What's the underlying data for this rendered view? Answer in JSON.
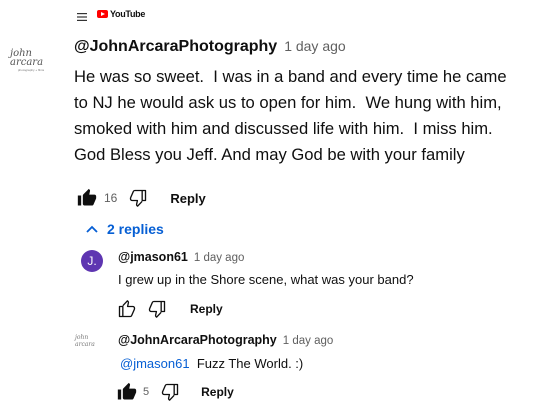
{
  "header": {
    "menu_icon": "hamburger-menu-icon",
    "logo_text": "YouTube"
  },
  "main_comment": {
    "avatar": {
      "brand": "john arcara",
      "sub": "photography + films"
    },
    "author": "@JohnArcaraPhotography",
    "time": "1 day ago",
    "text": "He was so sweet.  I was in a band and every time he came to NJ he would ask us to open for him.  We hung with him, smoked with him and discussed life with him.  I miss him. God Bless you Jeff. And may God be with your family",
    "like_count": "16",
    "reply_label": "Reply",
    "liked": true
  },
  "replies_toggle": {
    "label": "2 replies",
    "icon": "chevron-up-icon"
  },
  "replies": [
    {
      "avatar_letter": "J.",
      "avatar_color": "#5e35b1",
      "author": "@jmason61",
      "time": "1 day ago",
      "text": "I grew up in the Shore scene, what was your band?",
      "like_count": "",
      "reply_label": "Reply",
      "liked": false
    },
    {
      "avatar_brand": "john arcara",
      "author": "@JohnArcaraPhotography",
      "time": "1 day ago",
      "mention": "@jmason61",
      "text": "Fuzz The World. :)",
      "like_count": "5",
      "reply_label": "Reply",
      "liked": true
    }
  ],
  "colors": {
    "link_blue": "#065fd4",
    "secondary_text": "#606060",
    "youtube_red": "#ff0000"
  }
}
